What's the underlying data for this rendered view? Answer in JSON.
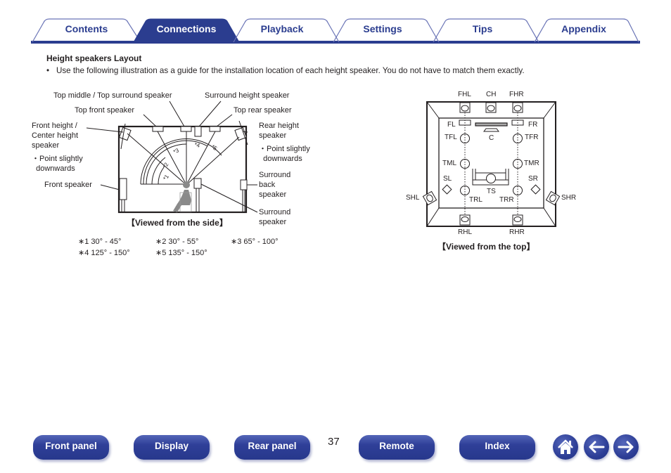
{
  "tabs": [
    {
      "label": "Contents",
      "active": false
    },
    {
      "label": "Connections",
      "active": true
    },
    {
      "label": "Playback",
      "active": false
    },
    {
      "label": "Settings",
      "active": false
    },
    {
      "label": "Tips",
      "active": false
    },
    {
      "label": "Appendix",
      "active": false
    }
  ],
  "colors": {
    "accent": "#2b3d8f",
    "active_tab": "#2b3d8f"
  },
  "section": {
    "heading": "Height speakers Layout",
    "bullet": "Use the following illustration as a guide for the installation location of each height speaker. You do not have to match them exactly."
  },
  "side_view": {
    "caption": "【Viewed from the side】",
    "labels": {
      "top_middle": "Top middle / Top surround speaker",
      "surround_height": "Surround height speaker",
      "top_front": "Top front speaker",
      "top_rear": "Top rear speaker",
      "front_height": "Front height /\nCenter height\nspeaker",
      "front_height_note": "・Point slightly\n  downwards",
      "rear_height": "Rear height\nspeaker",
      "rear_height_note": "・Point slightly\n  downwards",
      "front_speaker": "Front speaker",
      "surround_back": "Surround\nback\nspeaker",
      "surround": "Surround\nspeaker"
    },
    "angle_marks": [
      "*1",
      "*2",
      "*3",
      "*4",
      "*5"
    ],
    "notes": [
      "∗1 30° - 45°",
      "∗2 30° - 55°",
      "∗3 65° - 100°",
      "∗4 125° - 150°",
      "∗5 135° - 150°"
    ]
  },
  "top_view": {
    "caption": "【Viewed from the top】",
    "labels": {
      "FHL": "FHL",
      "CH": "CH",
      "FHR": "FHR",
      "FL": "FL",
      "FR": "FR",
      "C": "C",
      "TFL": "TFL",
      "TFR": "TFR",
      "TML": "TML",
      "TMR": "TMR",
      "SL": "SL",
      "SR": "SR",
      "TS": "TS",
      "TRL": "TRL",
      "TRR": "TRR",
      "SHL": "SHL",
      "SHR": "SHR",
      "RHL": "RHL",
      "RHR": "RHR"
    }
  },
  "footer": {
    "buttons": [
      "Front panel",
      "Display",
      "Rear panel",
      "Remote",
      "Index"
    ],
    "page_number": "37",
    "icons": [
      "home-icon",
      "back-arrow-icon",
      "forward-arrow-icon"
    ]
  }
}
